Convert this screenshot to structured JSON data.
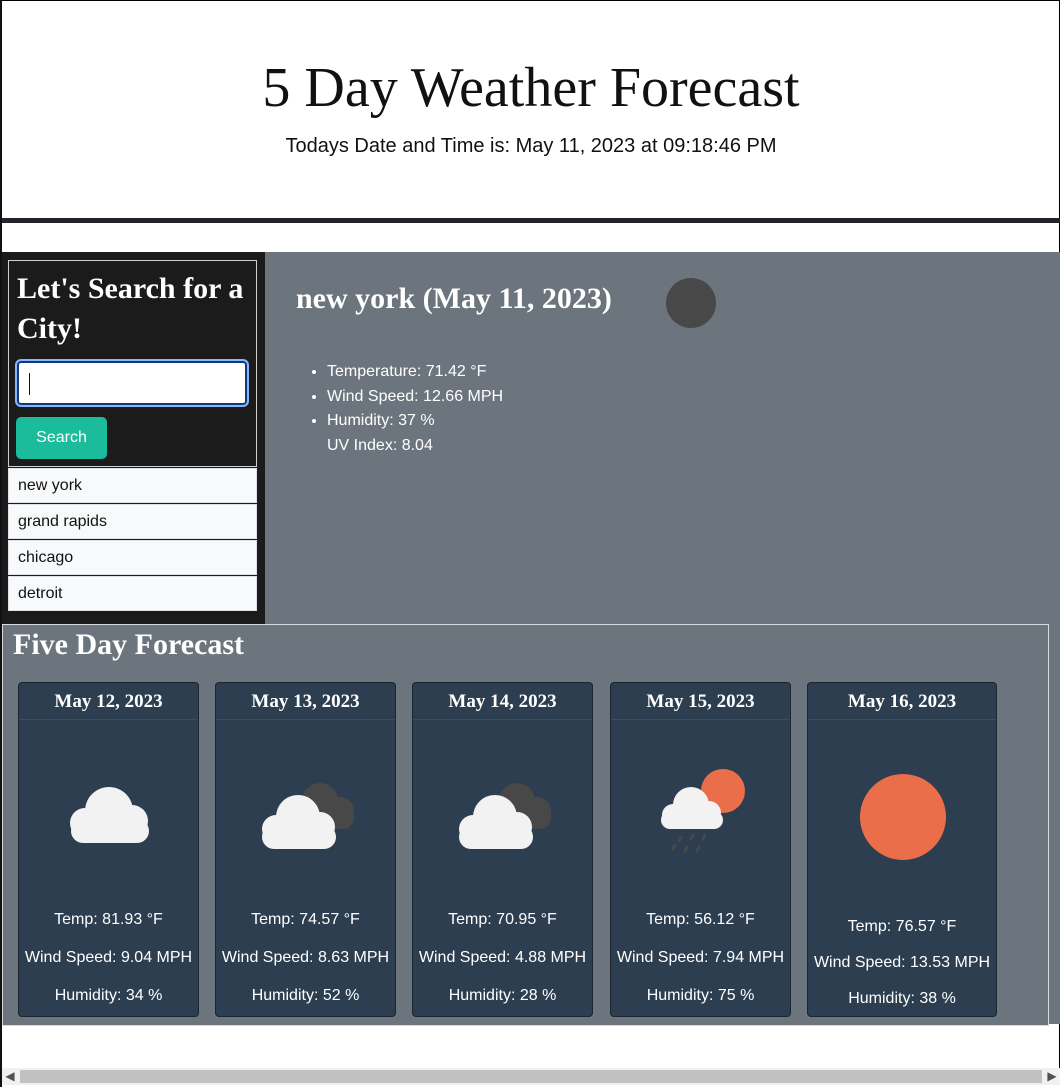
{
  "header": {
    "title": "5 Day Weather Forecast",
    "datetime_text": "Todays Date and Time is: May 11, 2023 at 09:18:46 PM"
  },
  "search": {
    "heading": "Let's Search for a City!",
    "input_value": "",
    "button_label": "Search",
    "history": [
      "new york",
      "grand rapids",
      "chicago",
      "detroit"
    ]
  },
  "current": {
    "title": "new york (May 11, 2023)",
    "icon": "dark-circle-icon",
    "temperature": "Temperature: 71.42 °F",
    "wind": "Wind Speed: 12.66 MPH",
    "humidity": "Humidity: 37 %",
    "uv": "UV Index: 8.04"
  },
  "forecast": {
    "heading": "Five Day Forecast",
    "days": [
      {
        "date": "May 12, 2023",
        "icon": "cloud-icon",
        "temp": "Temp: 81.93 °F",
        "wind": "Wind Speed: 9.04 MPH",
        "humidity": "Humidity: 34 %"
      },
      {
        "date": "May 13, 2023",
        "icon": "broken-clouds-icon",
        "temp": "Temp: 74.57 °F",
        "wind": "Wind Speed: 8.63 MPH",
        "humidity": "Humidity: 52 %"
      },
      {
        "date": "May 14, 2023",
        "icon": "broken-clouds-icon",
        "temp": "Temp: 70.95 °F",
        "wind": "Wind Speed: 4.88 MPH",
        "humidity": "Humidity: 28 %"
      },
      {
        "date": "May 15, 2023",
        "icon": "rain-sun-icon",
        "temp": "Temp: 56.12 °F",
        "wind": "Wind Speed: 7.94 MPH",
        "humidity": "Humidity: 75 %"
      },
      {
        "date": "May 16, 2023",
        "icon": "sun-icon",
        "temp": "Temp: 76.57 °F",
        "wind": "Wind Speed: 13.53 MPH",
        "humidity": "Humidity: 38 %"
      }
    ]
  },
  "colors": {
    "accent": "#1abc9c",
    "card_bg": "#2c3e50",
    "panel_bg": "#6c757d",
    "sun": "#eb6e4b",
    "cloud": "#f2f2f2",
    "dark_cloud": "#484848"
  }
}
